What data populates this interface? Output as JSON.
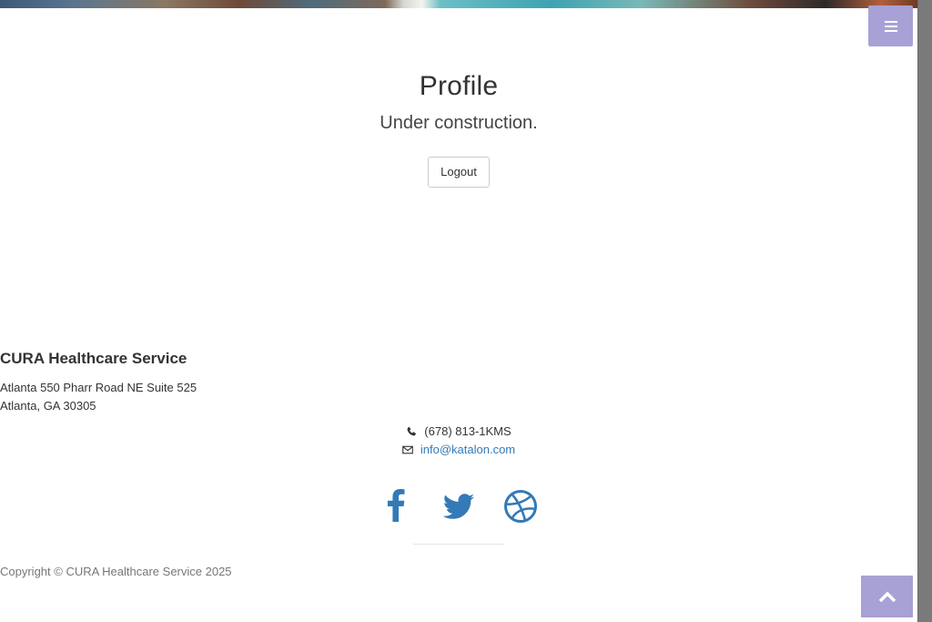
{
  "header": {
    "menu_icon": "bars-icon"
  },
  "main": {
    "title": "Profile",
    "subtitle": "Under construction.",
    "logout_label": "Logout"
  },
  "footer": {
    "company": "CURA Healthcare Service",
    "address_line1": "Atlanta 550 Pharr Road NE Suite 525",
    "address_line2": "Atlanta, GA 30305",
    "phone": "(678) 813-1KMS",
    "email": "info@katalon.com",
    "social": [
      {
        "name": "facebook",
        "icon": "facebook-icon"
      },
      {
        "name": "twitter",
        "icon": "twitter-icon"
      },
      {
        "name": "dribbble",
        "icon": "dribbble-icon"
      }
    ],
    "copyright": "Copyright © CURA Healthcare Service 2025"
  },
  "colors": {
    "accent": "#a7a1d6",
    "link": "#337ab7"
  }
}
